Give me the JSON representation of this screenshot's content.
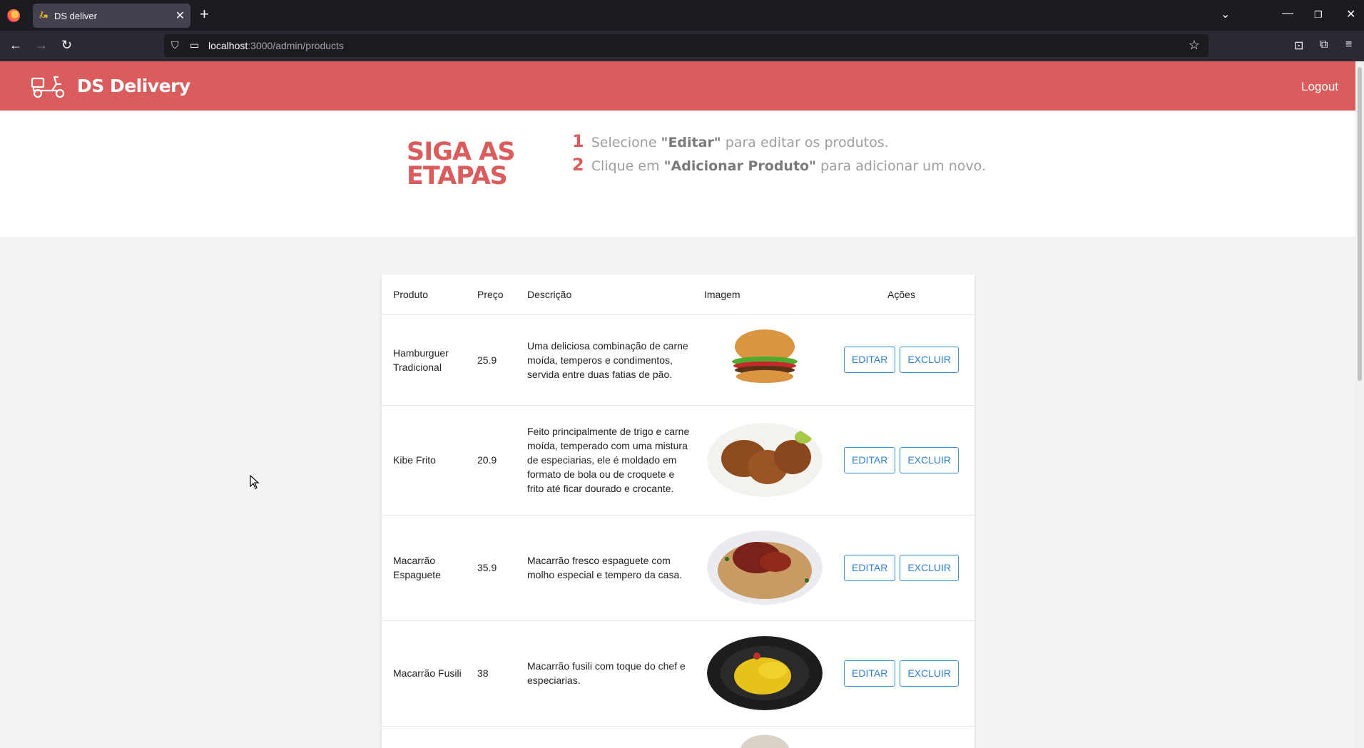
{
  "browser": {
    "tab_title": "DS deliver",
    "url_host": "localhost",
    "url_path": ":3000/admin/products"
  },
  "header": {
    "brand": "DS Delivery",
    "logout": "Logout"
  },
  "steps": {
    "title": "SIGA AS ETAPAS",
    "items": [
      {
        "num": "1",
        "before": "Selecione ",
        "bold": "\"Editar\"",
        "after": " para editar os produtos."
      },
      {
        "num": "2",
        "before": "Clique em ",
        "bold": "\"Adicionar Produto\"",
        "after": " para adicionar um novo."
      }
    ]
  },
  "table": {
    "headers": [
      "Produto",
      "Preço",
      "Descrição",
      "Imagem",
      "Ações"
    ],
    "edit_label": "EDITAR",
    "delete_label": "EXCLUIR",
    "rows": [
      {
        "name": "Hamburguer Tradicional",
        "price": "25.9",
        "description": "Uma deliciosa combinação de carne moída, temperos e condimentos, servida entre duas fatias de pão.",
        "image": "hamburger"
      },
      {
        "name": "Kibe Frito",
        "price": "20.9",
        "description": "Feito principalmente de trigo e carne moída, temperado com uma mistura de especiarias, ele é moldado em formato de bola ou de croquete e frito até ficar dourado e crocante.",
        "image": "kibe"
      },
      {
        "name": "Macarrão Espaguete",
        "price": "35.9",
        "description": "Macarrão fresco espaguete com molho especial e tempero da casa.",
        "image": "espaguete"
      },
      {
        "name": "Macarrão Fusili",
        "price": "38",
        "description": "Macarrão fusili com toque do chef e especiarias.",
        "image": "fusili"
      }
    ]
  },
  "colors": {
    "brand": "#da5c5c",
    "button_blue": "#2f80cf"
  }
}
